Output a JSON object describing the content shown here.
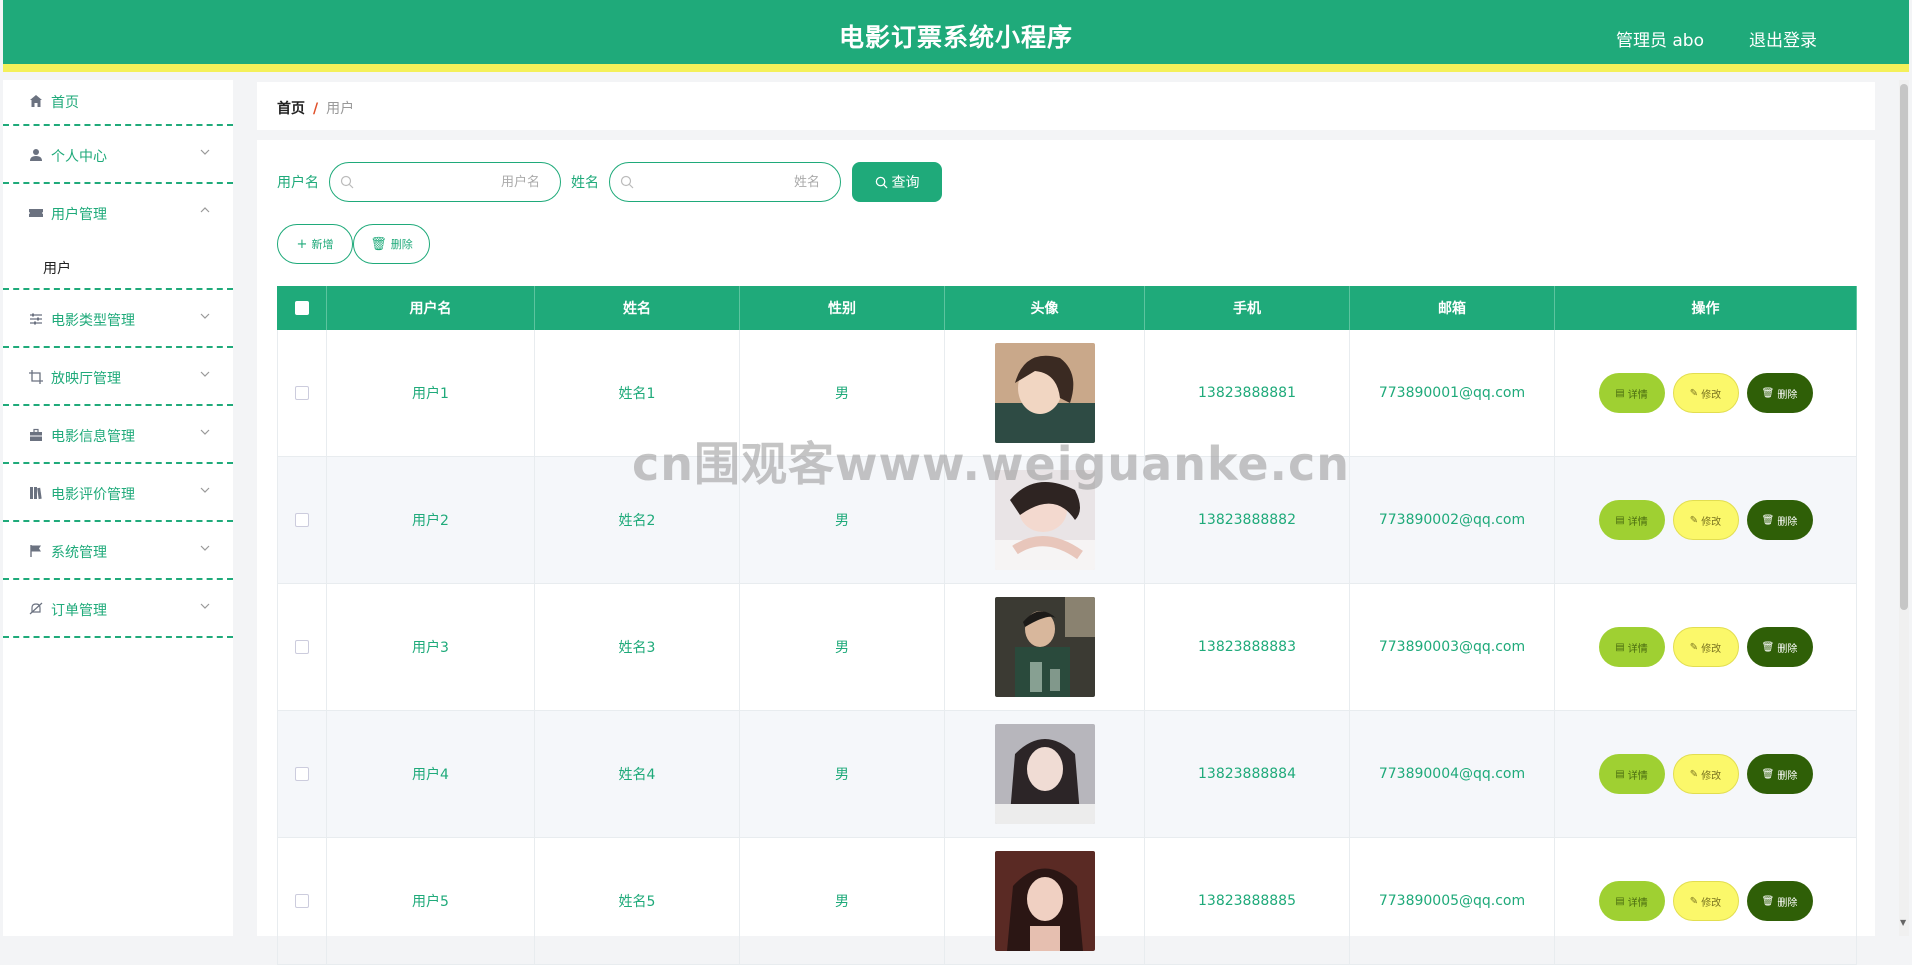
{
  "header": {
    "title": "电影订票系统小程序",
    "user": "管理员 abo",
    "logout": "退出登录"
  },
  "sidebar": {
    "items": [
      {
        "label": "首页",
        "icon": "home-icon"
      },
      {
        "label": "个人中心",
        "icon": "user-icon"
      },
      {
        "label": "用户管理",
        "icon": "ticket-icon",
        "expanded": true,
        "children": [
          "用户"
        ]
      },
      {
        "label": "电影类型管理",
        "icon": "sliders-icon"
      },
      {
        "label": "放映厅管理",
        "icon": "crop-icon"
      },
      {
        "label": "电影信息管理",
        "icon": "briefcase-icon"
      },
      {
        "label": "电影评价管理",
        "icon": "book-icon"
      },
      {
        "label": "系统管理",
        "icon": "flag-icon"
      },
      {
        "label": "订单管理",
        "icon": "bell-off-icon"
      }
    ]
  },
  "breadcrumb": {
    "home": "首页",
    "separator": "/",
    "current": "用户"
  },
  "search": {
    "username_label": "用户名",
    "username_placeholder": "用户名",
    "name_label": "姓名",
    "name_placeholder": "姓名",
    "query_button": "查询"
  },
  "actions": {
    "add": "新增",
    "delete": "删除"
  },
  "table": {
    "headers": [
      "用户名",
      "姓名",
      "性别",
      "头像",
      "手机",
      "邮箱",
      "操作"
    ],
    "rows": [
      {
        "username": "用户1",
        "name": "姓名1",
        "gender": "男",
        "phone": "13823888881",
        "email": "773890001@qq.com"
      },
      {
        "username": "用户2",
        "name": "姓名2",
        "gender": "男",
        "phone": "13823888882",
        "email": "773890002@qq.com"
      },
      {
        "username": "用户3",
        "name": "姓名3",
        "gender": "男",
        "phone": "13823888883",
        "email": "773890003@qq.com"
      },
      {
        "username": "用户4",
        "name": "姓名4",
        "gender": "男",
        "phone": "13823888884",
        "email": "773890004@qq.com"
      },
      {
        "username": "用户5",
        "name": "姓名5",
        "gender": "男",
        "phone": "13823888885",
        "email": "773890005@qq.com"
      }
    ],
    "row_actions": {
      "detail": "详情",
      "edit": "修改",
      "delete": "删除"
    }
  },
  "watermark": "cn围观客www.weiguanke.cn",
  "colors": {
    "primary": "#1faa7a",
    "accent_bar": "#f4f05a",
    "detail": "#9fd032",
    "edit": "#fbf86a",
    "delete": "#2f5f07"
  }
}
